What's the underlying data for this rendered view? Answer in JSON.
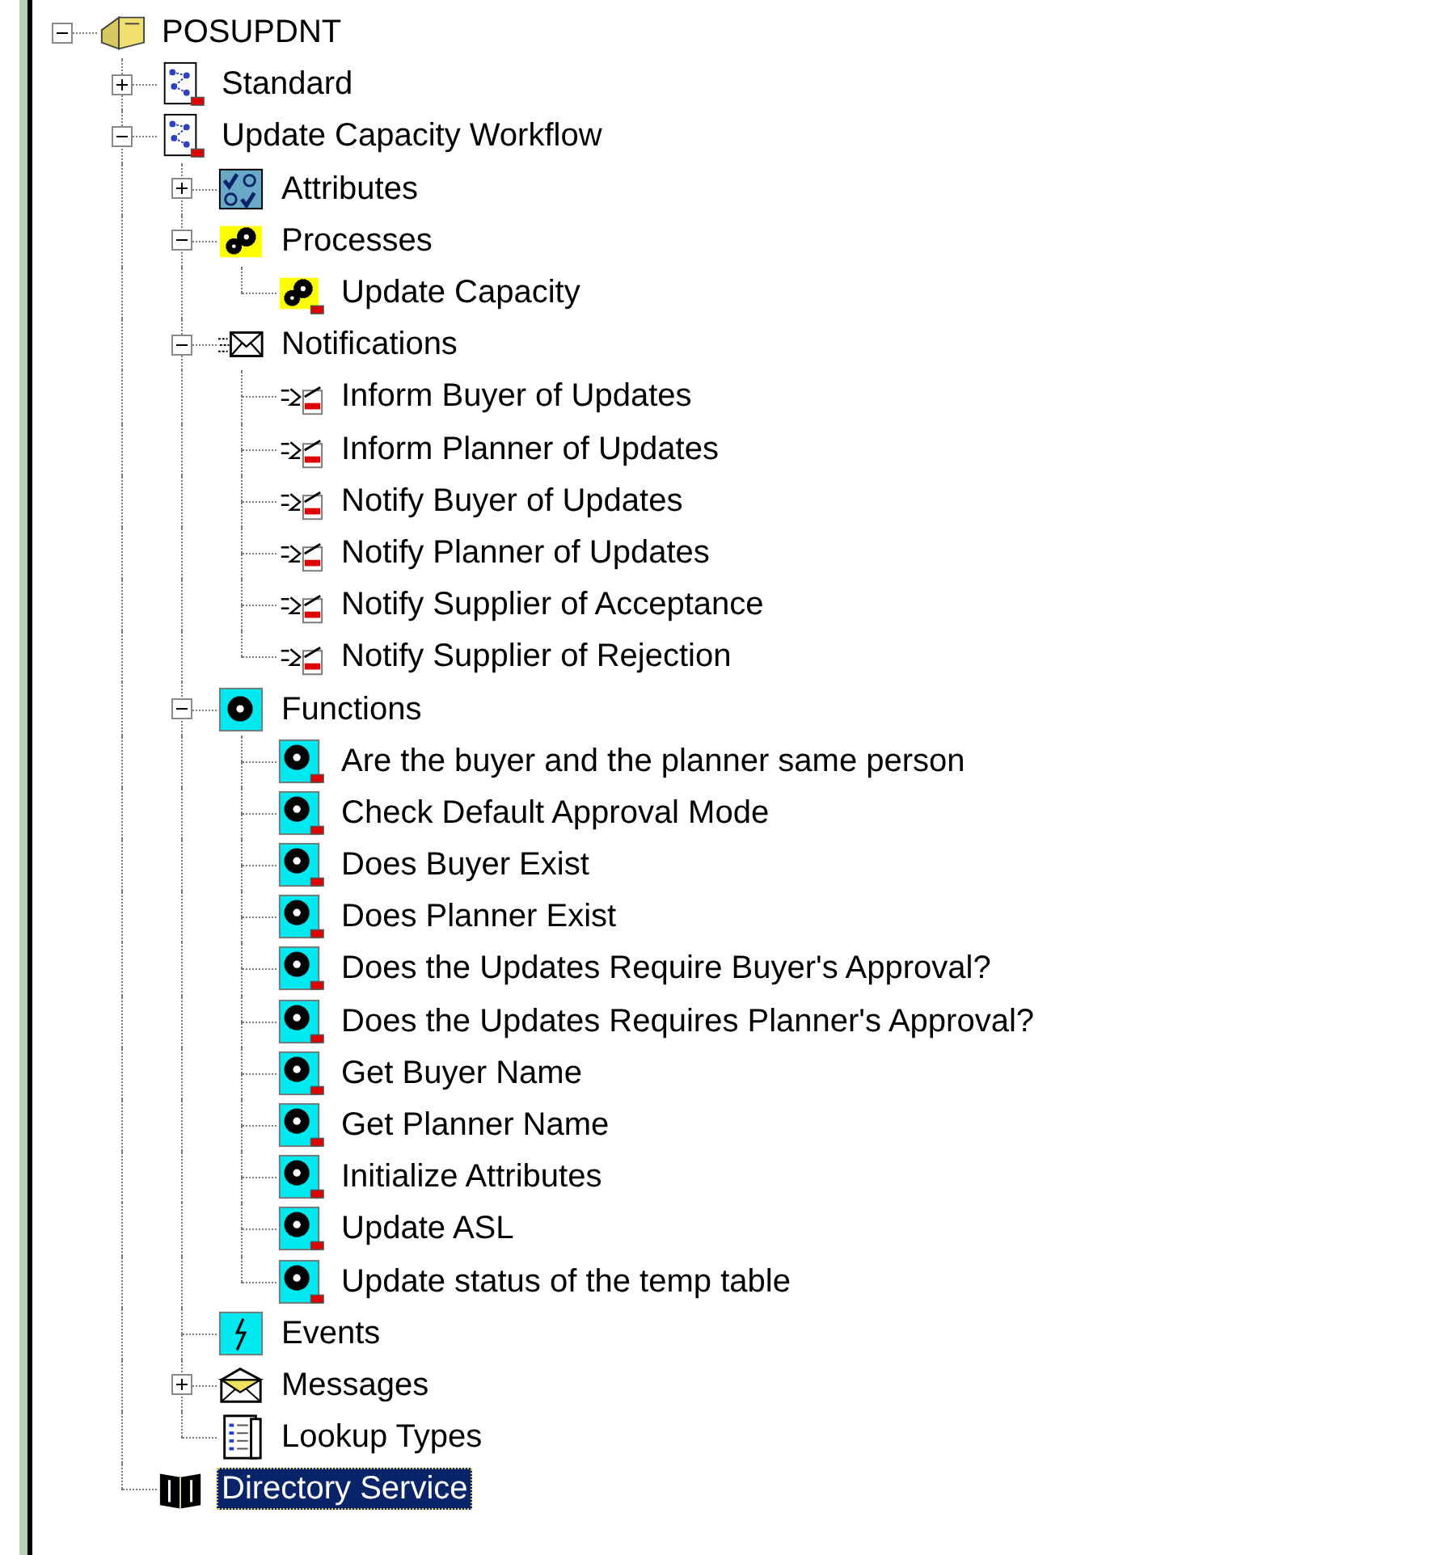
{
  "tree": [
    {
      "label": "POSUPDNT",
      "kind": "item_type",
      "expanded": true,
      "selected": false,
      "children": [
        {
          "label": "Standard",
          "kind": "process_doc",
          "expanded": false,
          "selected": false
        },
        {
          "label": "Update Capacity Workflow",
          "kind": "process_doc",
          "expanded": true,
          "selected": false,
          "children": [
            {
              "label": "Attributes",
              "kind": "attributes",
              "expanded": false,
              "selected": false
            },
            {
              "label": "Processes",
              "kind": "processes",
              "expanded": true,
              "selected": false,
              "children": [
                {
                  "label": "Update Capacity",
                  "kind": "process",
                  "selected": false
                }
              ]
            },
            {
              "label": "Notifications",
              "kind": "notifications",
              "expanded": true,
              "selected": false,
              "children": [
                {
                  "label": "Inform Buyer of Updates",
                  "kind": "notification",
                  "selected": false
                },
                {
                  "label": "Inform Planner of Updates",
                  "kind": "notification",
                  "selected": false
                },
                {
                  "label": "Notify Buyer of Updates",
                  "kind": "notification",
                  "selected": false
                },
                {
                  "label": "Notify Planner of Updates",
                  "kind": "notification",
                  "selected": false
                },
                {
                  "label": "Notify Supplier of Acceptance",
                  "kind": "notification",
                  "selected": false
                },
                {
                  "label": "Notify Supplier of Rejection",
                  "kind": "notification",
                  "selected": false
                }
              ]
            },
            {
              "label": "Functions",
              "kind": "functions",
              "expanded": true,
              "selected": false,
              "children": [
                {
                  "label": "Are the buyer and the planner same person",
                  "kind": "function",
                  "selected": false
                },
                {
                  "label": "Check Default Approval Mode",
                  "kind": "function",
                  "selected": false
                },
                {
                  "label": "Does Buyer Exist",
                  "kind": "function",
                  "selected": false
                },
                {
                  "label": "Does Planner Exist",
                  "kind": "function",
                  "selected": false
                },
                {
                  "label": "Does the Updates Require Buyer's Approval?",
                  "kind": "function",
                  "selected": false
                },
                {
                  "label": "Does the Updates Requires Planner's Approval?",
                  "kind": "function",
                  "selected": false
                },
                {
                  "label": "Get Buyer Name",
                  "kind": "function",
                  "selected": false
                },
                {
                  "label": "Get Planner Name",
                  "kind": "function",
                  "selected": false
                },
                {
                  "label": "Initialize Attributes",
                  "kind": "function",
                  "selected": false
                },
                {
                  "label": "Update ASL",
                  "kind": "function",
                  "selected": false
                },
                {
                  "label": "Update status of the temp table",
                  "kind": "function",
                  "selected": false
                }
              ]
            },
            {
              "label": "Events",
              "kind": "events",
              "selected": false
            },
            {
              "label": "Messages",
              "kind": "messages",
              "expanded": false,
              "selected": false
            },
            {
              "label": "Lookup Types",
              "kind": "lookup_types",
              "selected": false
            }
          ]
        },
        {
          "label": "Directory Service",
          "kind": "directory",
          "selected": true
        }
      ]
    }
  ]
}
